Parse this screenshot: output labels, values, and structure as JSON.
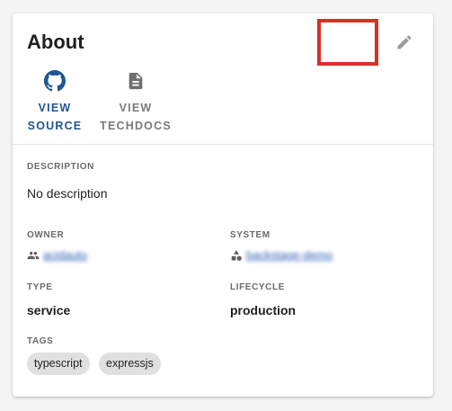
{
  "card": {
    "title": "About",
    "links": [
      {
        "line1": "VIEW",
        "line2": "SOURCE",
        "icon": "github-icon"
      },
      {
        "line1": "VIEW",
        "line2": "TECHDOCS",
        "icon": "document-icon"
      }
    ],
    "description": {
      "label": "DESCRIPTION",
      "value": "No description"
    },
    "owner": {
      "label": "OWNER",
      "value": "acidauto"
    },
    "system": {
      "label": "SYSTEM",
      "value": "backstage-demo"
    },
    "type": {
      "label": "TYPE",
      "value": "service"
    },
    "lifecycle": {
      "label": "LIFECYCLE",
      "value": "production"
    },
    "tags": {
      "label": "TAGS",
      "items": [
        "typescript",
        "expressjs"
      ]
    }
  },
  "colors": {
    "accent": "#1f5493",
    "highlight_border": "#d93025",
    "link": "#2d5fb4"
  }
}
